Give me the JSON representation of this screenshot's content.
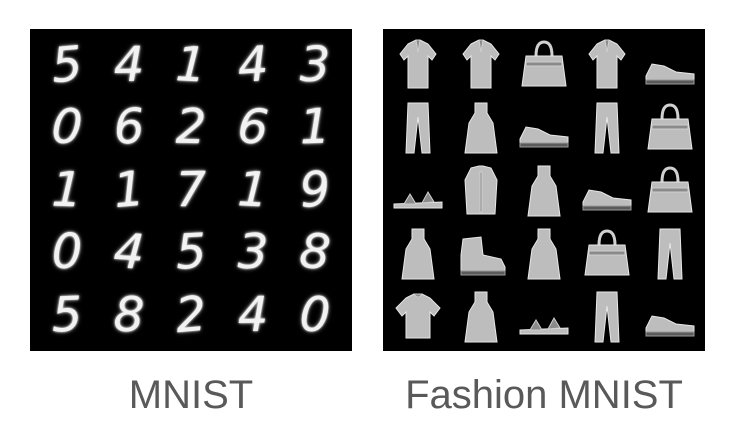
{
  "panels": {
    "mnist": {
      "caption": "MNIST",
      "digits": [
        "5",
        "4",
        "1",
        "4",
        "3",
        "0",
        "6",
        "2",
        "6",
        "1",
        "1",
        "1",
        "7",
        "1",
        "9",
        "0",
        "4",
        "5",
        "3",
        "8",
        "5",
        "8",
        "2",
        "4",
        "0"
      ]
    },
    "fashion": {
      "caption": "Fashion MNIST",
      "items": [
        {
          "icon": "shirt-icon"
        },
        {
          "icon": "shirt-icon"
        },
        {
          "icon": "bag-icon"
        },
        {
          "icon": "shirt-icon"
        },
        {
          "icon": "sneaker-icon"
        },
        {
          "icon": "trouser-icon"
        },
        {
          "icon": "dress-icon"
        },
        {
          "icon": "sneaker-icon"
        },
        {
          "icon": "trouser-icon"
        },
        {
          "icon": "bag-icon"
        },
        {
          "icon": "sandal-icon"
        },
        {
          "icon": "coat-icon"
        },
        {
          "icon": "dress-icon"
        },
        {
          "icon": "sneaker-icon"
        },
        {
          "icon": "bag-icon"
        },
        {
          "icon": "dress-icon"
        },
        {
          "icon": "ankle-boot-icon"
        },
        {
          "icon": "dress-icon"
        },
        {
          "icon": "bag-icon"
        },
        {
          "icon": "trouser-icon"
        },
        {
          "icon": "tshirt-icon"
        },
        {
          "icon": "dress-icon"
        },
        {
          "icon": "sandal-icon"
        },
        {
          "icon": "trouser-icon"
        },
        {
          "icon": "sneaker-icon"
        }
      ]
    }
  },
  "colors": {
    "background": "#ffffff",
    "panel": "#000000",
    "caption": "#595959",
    "glyph": "#f2f2f2"
  }
}
